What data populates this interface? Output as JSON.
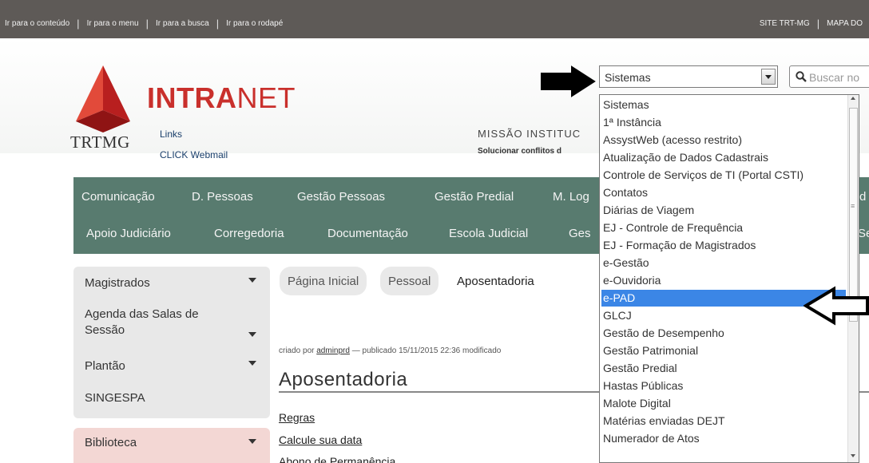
{
  "topbar": {
    "links": [
      "Ir para o conteúdo",
      "Ir para o menu",
      "Ir para a busca",
      "Ir para o rodapé"
    ],
    "right_links": [
      "SITE TRT-MG",
      "MAPA DO"
    ]
  },
  "header": {
    "logo_text": "TRTMG",
    "brand_bold": "INTRA",
    "brand_thin": "NET",
    "links": [
      "Links",
      "CLICK Webmail"
    ],
    "mission": "MISSÃO INSTITUC",
    "mission_sub": "Solucionar conflitos d"
  },
  "systems_select": {
    "value": "Sistemas",
    "options": [
      "Sistemas",
      "1ª Instância",
      "AssystWeb (acesso restrito)",
      "Atualização de Dados Cadastrais",
      "Controle de Serviços de TI (Portal CSTI)",
      "Contatos",
      "Diárias de Viagem",
      "EJ - Controle de Frequência",
      "EJ - Formação de Magistrados",
      "e-Gestão",
      "e-Ouvidoria",
      "e-PAD",
      "GLCJ",
      "Gestão de Desempenho",
      "Gestão Patrimonial",
      "Gestão Predial",
      "Hastas Públicas",
      "Malote Digital",
      "Matérias enviadas DEJT",
      "Numerador de Atos"
    ],
    "selected_index": 11
  },
  "search": {
    "placeholder": "Buscar no"
  },
  "nav": {
    "row1": [
      "Comunicação",
      "D. Pessoas",
      "Gestão Pessoas",
      "Gestão Predial",
      "M. Log",
      "d"
    ],
    "row2": [
      "Apoio Judiciário",
      "Corregedoria",
      "Documentação",
      "Escola Judicial",
      "Ges",
      "Se"
    ]
  },
  "sidebar": {
    "items": [
      "Magistrados",
      "Agenda das Salas de Sessão",
      "Plantão",
      "SINGESPA"
    ],
    "biblioteca": "Biblioteca"
  },
  "breadcrumb": [
    "Página Inicial",
    "Pessoal",
    "Aposentadoria"
  ],
  "content": {
    "byline_prefix": "criado por",
    "author": "adminprd",
    "byline_rest": "— publicado 15/11/2015 22:36 modificado",
    "title": "Aposentadoria",
    "links": [
      "Regras",
      "Calcule sua data",
      "Abono de Permanência"
    ]
  },
  "colors": {
    "nav_bg": "#587b6f",
    "brand_red": "#c9302c",
    "selected_option": "#3b86e6",
    "topbar_bg": "#5e5a57"
  }
}
